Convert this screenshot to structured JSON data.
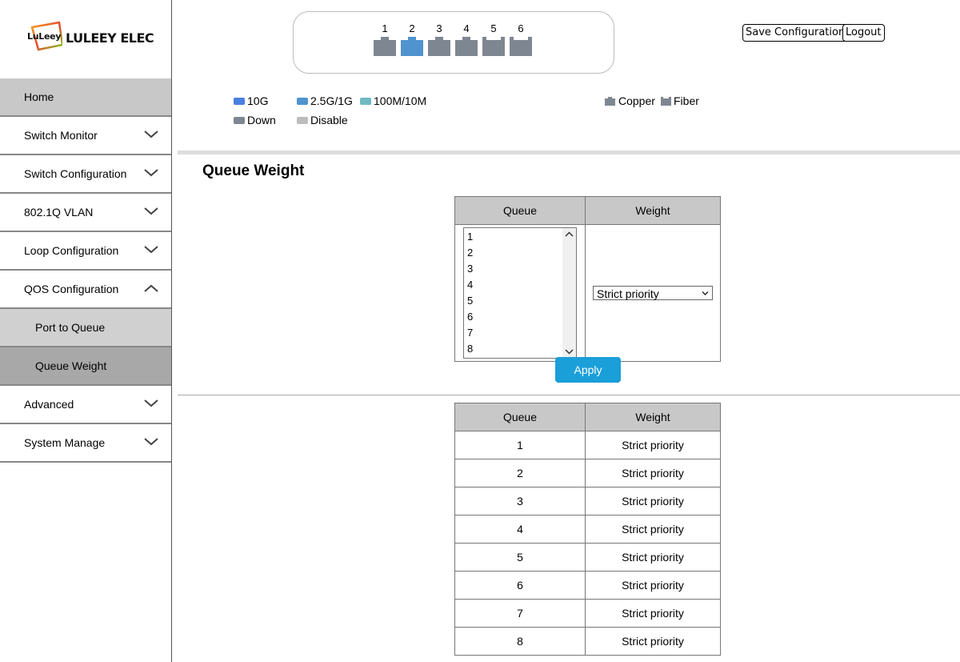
{
  "brand": {
    "badge": "LuLeey",
    "name": "LULEEY ELEC"
  },
  "nav": {
    "items": [
      {
        "label": "Home"
      },
      {
        "label": "Switch Monitor"
      },
      {
        "label": "Switch Configuration"
      },
      {
        "label": "802.1Q VLAN"
      },
      {
        "label": "Loop Configuration"
      },
      {
        "label": "QOS Configuration",
        "expanded": true,
        "children": [
          {
            "label": "Port to Queue"
          },
          {
            "label": "Queue Weight",
            "active": true
          }
        ]
      },
      {
        "label": "Advanced"
      },
      {
        "label": "System Manage"
      }
    ]
  },
  "ports": [
    {
      "num": "1",
      "status": "down",
      "color": "#7e8691"
    },
    {
      "num": "2",
      "status": "2.5G/1G",
      "color": "#4f93cf"
    },
    {
      "num": "3",
      "status": "down",
      "color": "#7e8691"
    },
    {
      "num": "4",
      "status": "down",
      "color": "#7e8691"
    },
    {
      "num": "5",
      "status": "down",
      "color": "#7e8691"
    },
    {
      "num": "6",
      "status": "down",
      "color": "#7e8691"
    }
  ],
  "header": {
    "save_label": "Save Configuration",
    "logout_label": "Logout"
  },
  "legend": {
    "g10": "10G",
    "g25": "2.5G/1G",
    "m100": "100M/10M",
    "down": "Down",
    "disable": "Disable",
    "copper": "Copper",
    "fiber": "Fiber",
    "colors": {
      "g10": "#4a7fe0",
      "g25": "#4f93cf",
      "m100": "#6fb8c4",
      "down": "#7e8691",
      "disable": "#bdbdbd"
    }
  },
  "page": {
    "title": "Queue Weight"
  },
  "form": {
    "col_queue": "Queue",
    "col_weight": "Weight",
    "queues": [
      "1",
      "2",
      "3",
      "4",
      "5",
      "6",
      "7",
      "8"
    ],
    "weight_selected": "Strict priority",
    "apply_label": "Apply"
  },
  "list": {
    "col_queue": "Queue",
    "col_weight": "Weight",
    "rows": [
      {
        "queue": "1",
        "weight": "Strict priority"
      },
      {
        "queue": "2",
        "weight": "Strict priority"
      },
      {
        "queue": "3",
        "weight": "Strict priority"
      },
      {
        "queue": "4",
        "weight": "Strict priority"
      },
      {
        "queue": "5",
        "weight": "Strict priority"
      },
      {
        "queue": "6",
        "weight": "Strict priority"
      },
      {
        "queue": "7",
        "weight": "Strict priority"
      },
      {
        "queue": "8",
        "weight": "Strict priority"
      }
    ]
  }
}
